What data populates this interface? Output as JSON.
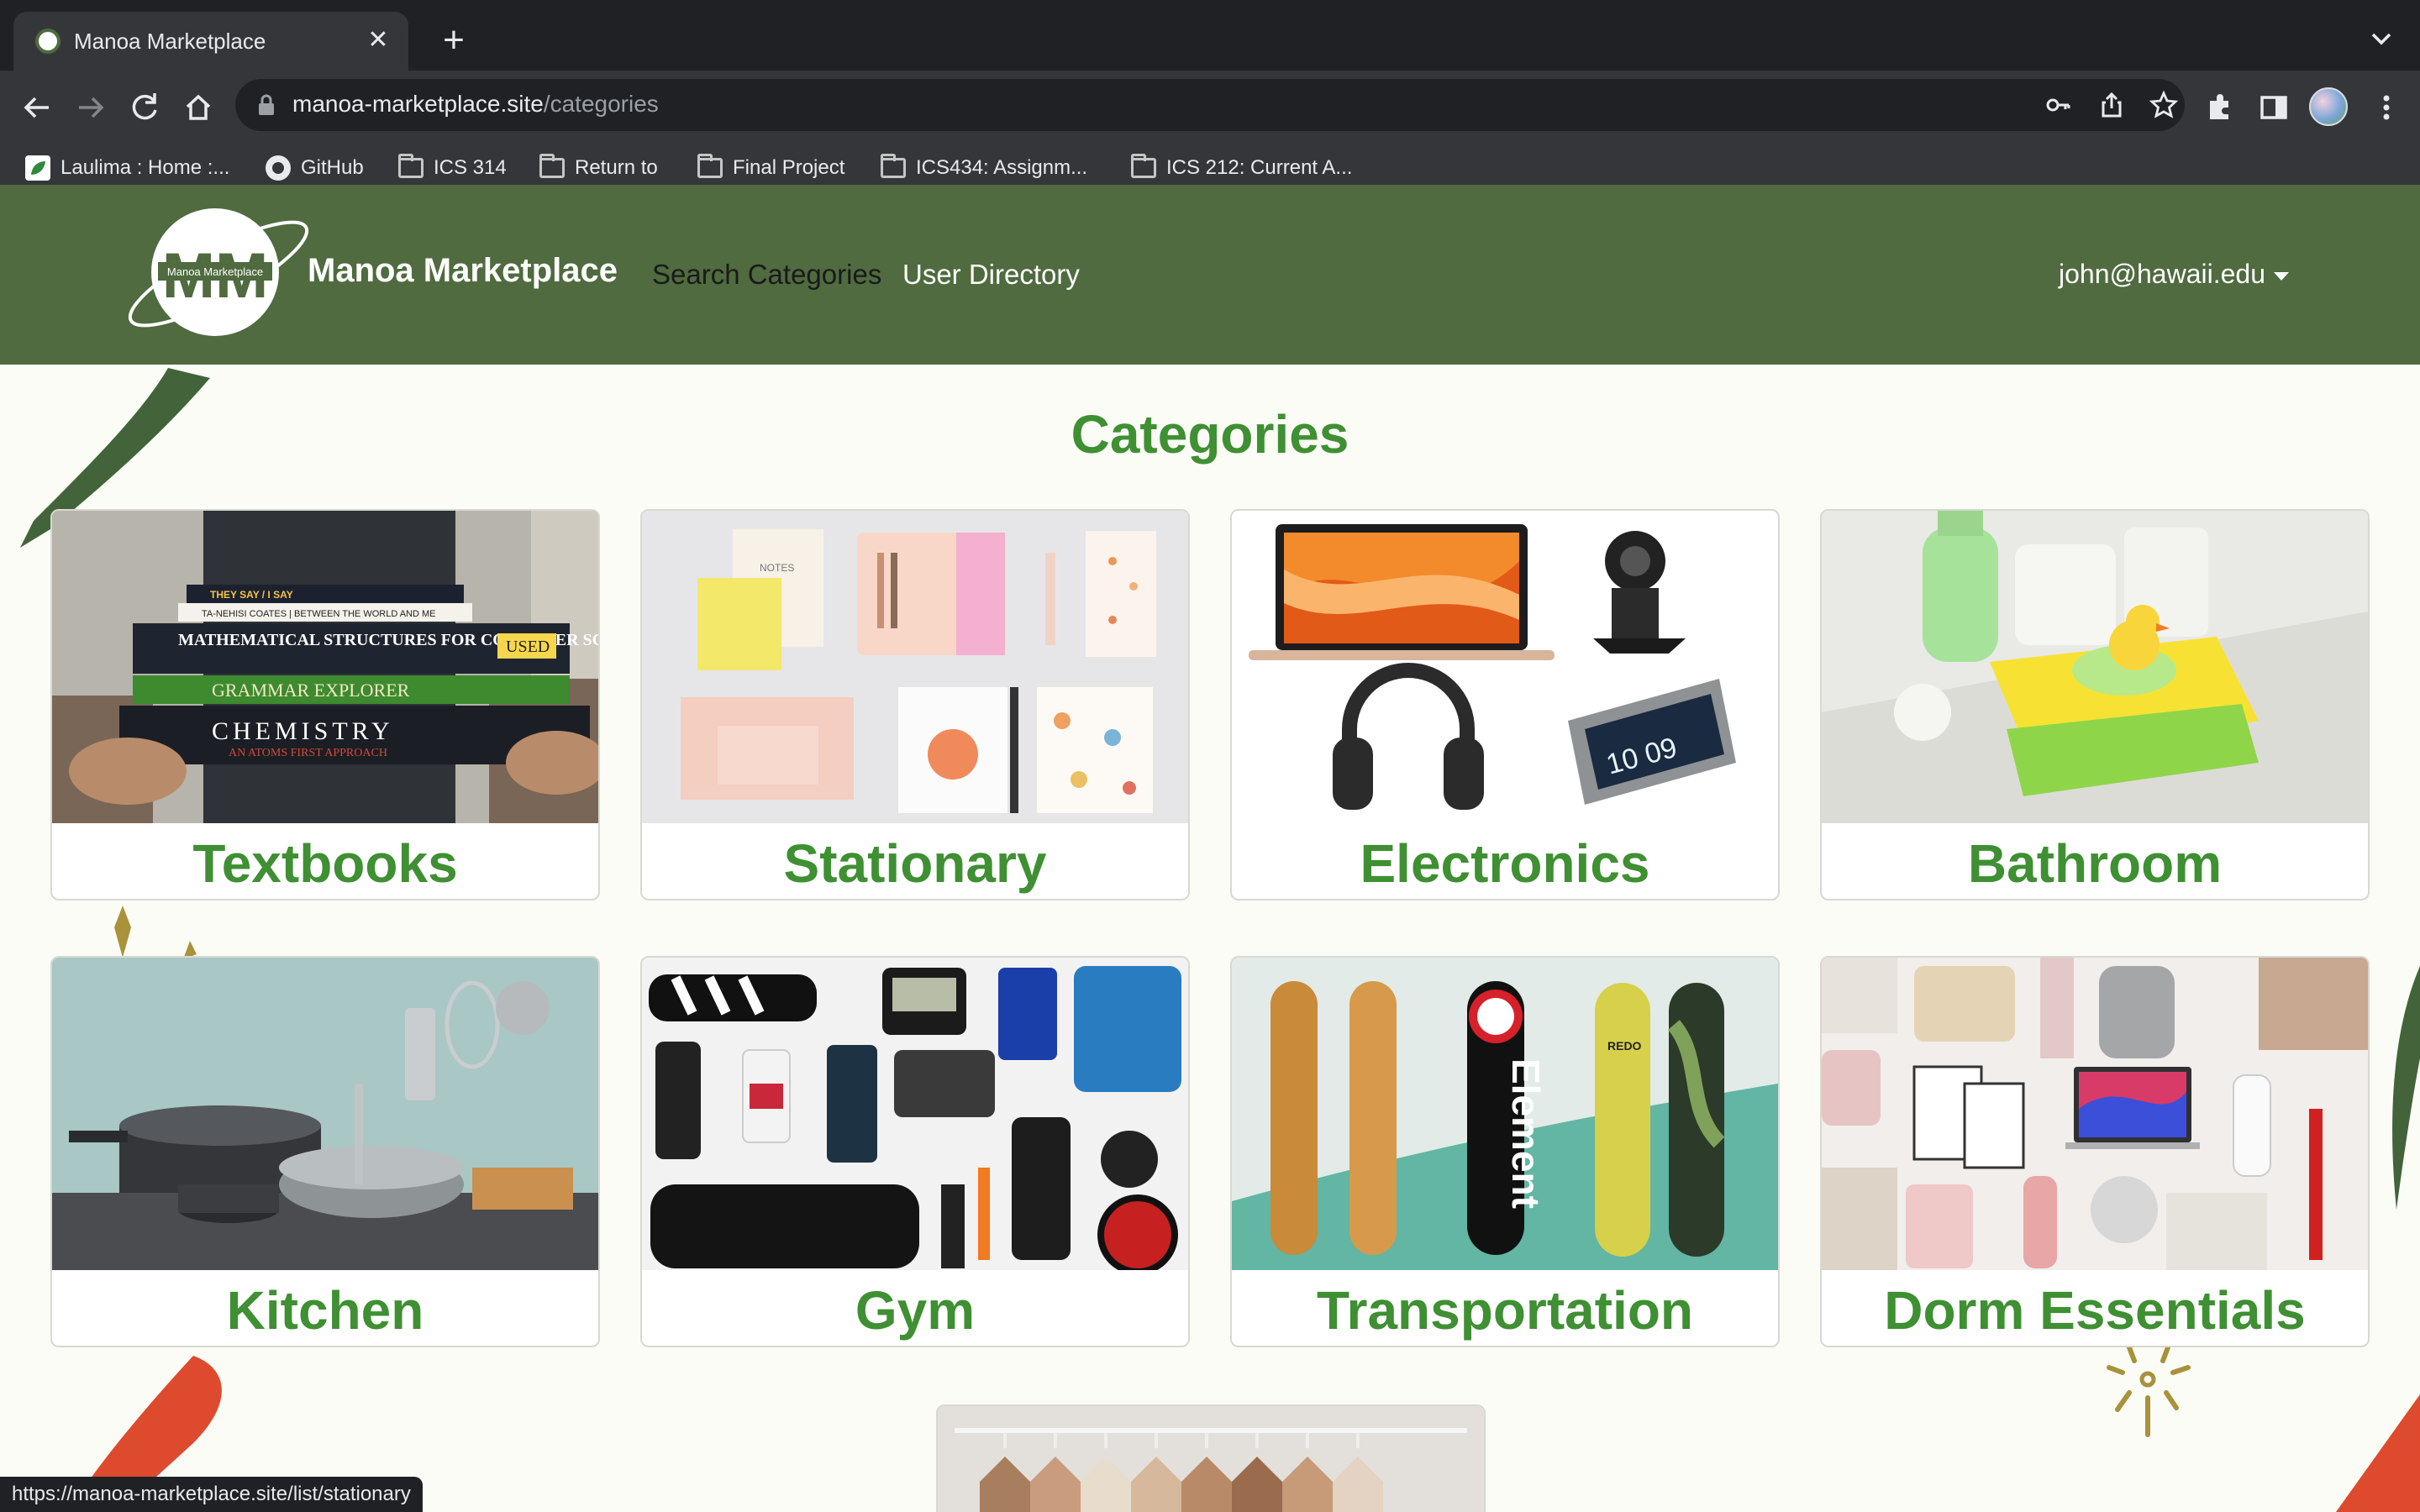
{
  "browser": {
    "tab_title": "Manoa Marketplace",
    "url_host": "manoa-marketplace.site",
    "url_path": "/categories",
    "bookmarks": [
      {
        "label": "Laulima : Home :...",
        "icon": "laulima-icon"
      },
      {
        "label": "GitHub",
        "icon": "github-icon"
      },
      {
        "label": "ICS 314",
        "icon": "folder-icon"
      },
      {
        "label": "Return to",
        "icon": "folder-icon"
      },
      {
        "label": "Final Project",
        "icon": "folder-icon"
      },
      {
        "label": "ICS434: Assignm...",
        "icon": "folder-icon"
      },
      {
        "label": "ICS 212: Current A...",
        "icon": "folder-icon"
      }
    ],
    "status_url": "https://manoa-marketplace.site/list/stationary"
  },
  "navbar": {
    "logo_text": "Manoa Marketplace",
    "logo_letters": "MM",
    "brand": "Manoa Marketplace",
    "links": [
      "Search Categories",
      "User Directory"
    ],
    "user": "john@hawaii.edu",
    "color": "#4f6b3f"
  },
  "main": {
    "title": "Categories",
    "accent": "#3f8f33",
    "categories": [
      {
        "label": "Textbooks",
        "image": "textbook-stack-image"
      },
      {
        "label": "Stationary",
        "image": "stationery-flatlay-image"
      },
      {
        "label": "Electronics",
        "image": "electronics-collage-image"
      },
      {
        "label": "Bathroom",
        "image": "bathroom-towels-image"
      },
      {
        "label": "Kitchen",
        "image": "kitchen-cookware-image"
      },
      {
        "label": "Gym",
        "image": "gym-gear-image"
      },
      {
        "label": "Transportation",
        "image": "skateboards-image"
      },
      {
        "label": "Dorm Essentials",
        "image": "dorm-essentials-image"
      }
    ],
    "textbook_spines": [
      "THEY SAY / I SAY",
      "TA-NEHISI COATES | BETWEEN THE WORLD AND ME",
      "MATHEMATICAL STRUCTURES FOR COMPUTER SCIENCE",
      "USED",
      "GRAMMAR EXPLORER",
      "CHEMISTRY",
      "AN ATOMS FIRST APPROACH"
    ],
    "notes_label": "NOTES",
    "clock_time": "10 09",
    "skate_brand": "Element",
    "skate_brand2": "REDO"
  }
}
